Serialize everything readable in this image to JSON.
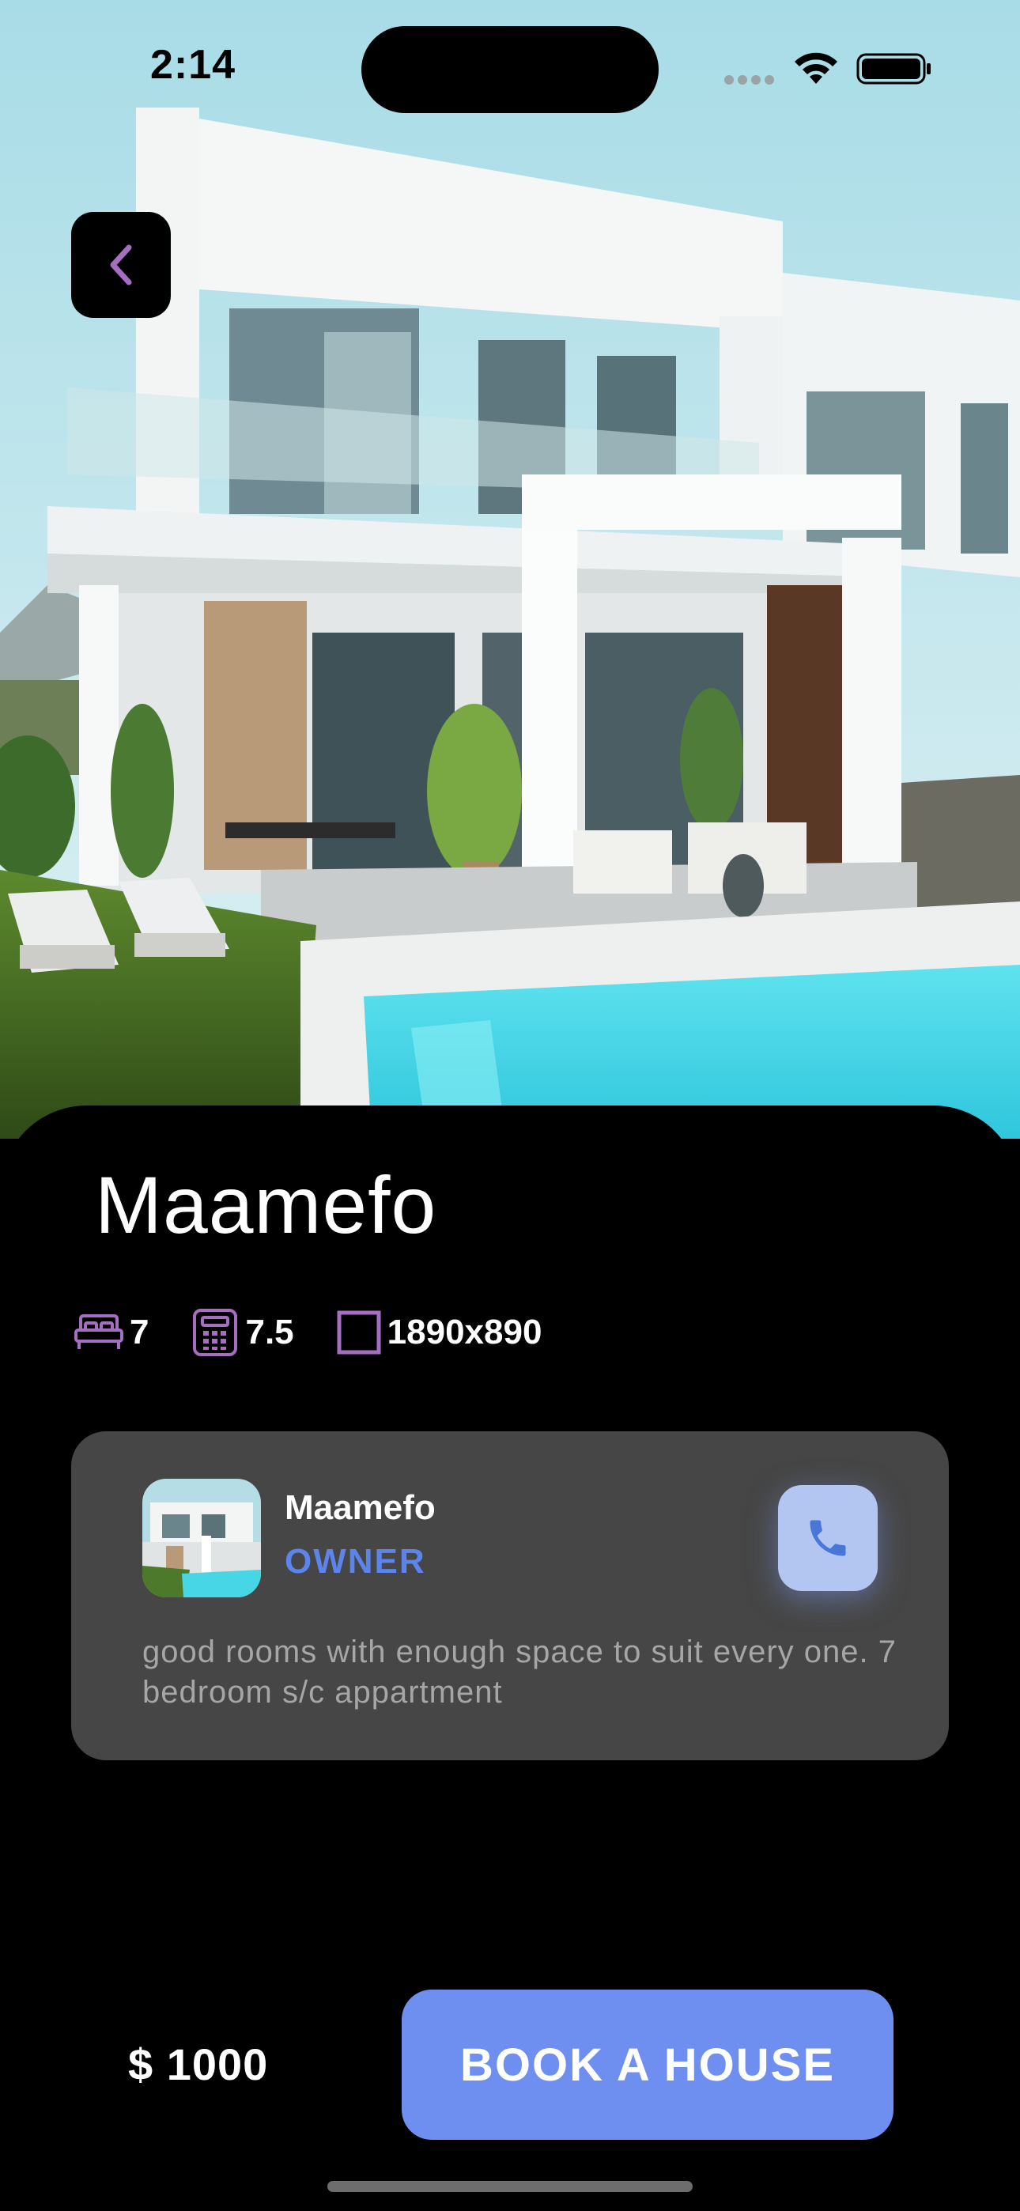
{
  "status_bar": {
    "time": "2:14"
  },
  "hero": {
    "image": "house-with-pool-photo"
  },
  "back_button": {
    "icon": "chevron-left-icon",
    "color": "#a66ec0"
  },
  "property": {
    "name": "Maamefo",
    "features": [
      {
        "icon": "bed-icon",
        "value": "7"
      },
      {
        "icon": "calculator-icon",
        "value": "7.5"
      },
      {
        "icon": "square-area-icon",
        "value": "1890x890"
      }
    ]
  },
  "owner": {
    "name": "Maamefo",
    "role": "OWNER",
    "description": "good rooms with enough space to suit every one. 7 bedroom s/c appartment",
    "call_icon": "phone-icon"
  },
  "footer": {
    "price": "$ 1000",
    "book_label": "BOOK A HOUSE"
  },
  "colors": {
    "accent": "#6e8ef0",
    "owner_role": "#5b84ec",
    "icon_purple": "#a66ec0",
    "card_bg": "#464646"
  }
}
